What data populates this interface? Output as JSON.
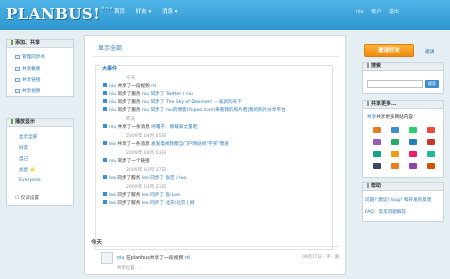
{
  "header": {
    "logo": "PLANBUS!",
    "logo_sup": "Beta",
    "nav": [
      "首页",
      "好友 ▾",
      "消息 ▾"
    ],
    "user_nav": [
      "niu",
      "帐户",
      "退出"
    ]
  },
  "left": {
    "panel1_title": "添加、共享",
    "panel1_items": [
      "管理同步点",
      "共享概要",
      "共享链接",
      "共享视频"
    ],
    "panel2_title": "播放显示",
    "panel2_items": [
      "显示全部",
      "好友",
      "自己",
      "加星 ⭐",
      "Everyone"
    ],
    "panel2_footer": "☐ 仅读设置"
  },
  "main": {
    "title": "显示全部",
    "events_title": "大事件",
    "events": [
      {
        "kind": "date",
        "text": "今天"
      },
      {
        "kind": "item",
        "user": "niu",
        "text": "共享了一段视频",
        "extra": "rd"
      },
      {
        "kind": "item",
        "user": "niu",
        "text": "同步了服务",
        "extra": "niu 同步了 Twitter / niu"
      },
      {
        "kind": "item",
        "user": "niu",
        "text": "同步了服务",
        "extra": "niu 同步了 The Sky of Daemon! -- 威武的天下"
      },
      {
        "kind": "item",
        "user": "niu",
        "text": "同步了服务",
        "extra": "niu 同步了 niu的博客(Yupoo.com)来看我的照片吧|我的照片分享平台"
      },
      {
        "kind": "date",
        "text": "昨天"
      },
      {
        "kind": "item",
        "user": "niu",
        "text": "共享了一条消息",
        "extra": "呼噜子：哪载来丈量吧"
      },
      {
        "kind": "date",
        "text": "2009年 04月 05日"
      },
      {
        "kind": "item",
        "user": "leo",
        "text": "共享了一条消息",
        "extra": "发发电视我都当门户网站的\"不买\"而道"
      },
      {
        "kind": "date",
        "text": "2009年 04月 03日"
      },
      {
        "kind": "item",
        "user": "niu",
        "text": "同步了一个链接",
        "extra": ""
      },
      {
        "kind": "date",
        "text": "2009年 03月 27日"
      },
      {
        "kind": "item",
        "user": "leo",
        "text": "同步了服务",
        "extra": "leo 同步了 饭否 / leo"
      },
      {
        "kind": "date",
        "text": "2009年 03月 21日"
      },
      {
        "kind": "item",
        "user": "leo",
        "text": "同步了服务",
        "extra": "leo 同步了 饭-Leo"
      },
      {
        "kind": "item",
        "user": "leo",
        "text": "同步了服务",
        "extra": "leo 同步了 北京/北京 | 顾"
      }
    ],
    "today_label": "今天",
    "tweet_user": "niu",
    "tweet_text": "在planbus共享了一段视频",
    "tweet_extra": "rd",
    "tweet_meta": "06月17日 · 评 · 删",
    "tweet_sub": "共享位置：.."
  },
  "right": {
    "invite_button": "邀请好友",
    "invite_link": "邀请",
    "search_title": "搜索",
    "search_button": "搜索",
    "share_title": "共享更多...",
    "share_text": "共享更多网站内容：",
    "share_link": "共享",
    "help_title": "帮助",
    "help_items": [
      "问题? 建议? bug? 和开发的反馈",
      "FAQ：常见问题解答"
    ],
    "icon_colors": [
      "#e67e22",
      "#3b8fd0",
      "#2ecc71",
      "#e74c3c",
      "#9b59b6",
      "#27ae60",
      "#2980b9",
      "#c0392b",
      "#16a085",
      "#f39c12",
      "#e91e63",
      "#1abc9c",
      "#34495e",
      "#e67e22",
      "#8e44ad",
      "#d35400"
    ]
  }
}
